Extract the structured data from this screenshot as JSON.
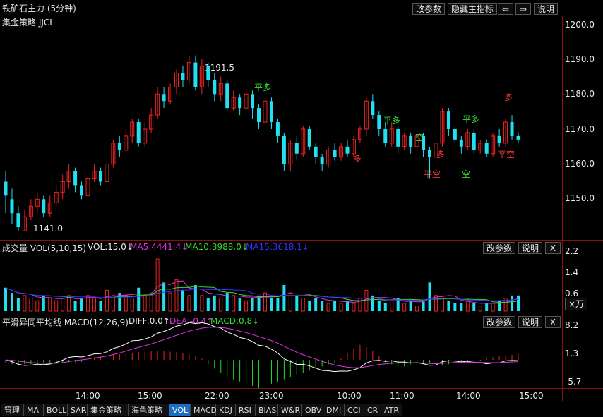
{
  "title": "铁矿石主力 (5分钟)",
  "toolbar": {
    "params": "改参数",
    "hide_indicator": "隐藏主指标",
    "left": "⇐",
    "right": "⇒",
    "help": "说明"
  },
  "main": {
    "strategy": "集金策略 JJCL",
    "y_labels": [
      "1200.0",
      "1190.0",
      "1180.0",
      "1170.0",
      "1160.0",
      "1150.0"
    ],
    "high_label": "1191.5",
    "low_label": "1141.0",
    "signals": [
      {
        "text": "平多",
        "color": "#33dd33"
      },
      {
        "text": "多",
        "color": "#ee3333"
      },
      {
        "text": "平多",
        "color": "#33dd33"
      },
      {
        "text": "空",
        "color": "#33dd33"
      },
      {
        "text": "多",
        "color": "#ee3333"
      },
      {
        "text": "平空",
        "color": "#ee3333"
      },
      {
        "text": "平多",
        "color": "#33dd33"
      },
      {
        "text": "空",
        "color": "#33dd33"
      },
      {
        "text": "多",
        "color": "#ee3333"
      },
      {
        "text": "平空",
        "color": "#ee3333"
      }
    ]
  },
  "volume": {
    "title": "成交量 VOL(5,10,15)",
    "vol": "VOL:15.0↓",
    "ma5": "MA5:4441.4↓",
    "ma10": "MA10:3988.0↓",
    "ma15": "MA15:3618.1↓",
    "params": "改参数",
    "help": "说明",
    "close": "X",
    "y_labels": [
      "2.2",
      "1.4",
      "0.6"
    ],
    "unit": "×万",
    "colors": {
      "ma5": "#dd33dd",
      "ma10": "#33dd33",
      "ma15": "#3333ff"
    }
  },
  "macd": {
    "title": "平滑异同平均线 MACD(12,26,9)",
    "diff": "DIFF:0.0↑",
    "dea": "DEA:-0.4↑",
    "macd": "MACD:0.8↓",
    "params": "改参数",
    "help": "说明",
    "close": "X",
    "y_labels": [
      "8.2",
      "1.3",
      "-5.7"
    ]
  },
  "x_labels": [
    "14:00",
    "15:00",
    "22:00",
    "23:00",
    "10:00",
    "11:00",
    "14:00",
    "15:00"
  ],
  "tabs": [
    "管理",
    "MA",
    "BOLL",
    "SAR",
    "集金策略",
    "海龟策略",
    "VOL",
    "MACD",
    "KDJ",
    "RSI",
    "BIAS",
    "W&R",
    "OBV",
    "DMI",
    "CCI",
    "CR",
    "ATR"
  ],
  "active_tab": "VOL",
  "chart_data": {
    "type": "candlestick",
    "ylim": [
      1140,
      1202
    ],
    "candles": [
      [
        1155,
        1151,
        1158,
        1146
      ],
      [
        1150,
        1146,
        1153,
        1143
      ],
      [
        1146,
        1142,
        1148,
        1141
      ],
      [
        1141,
        1145,
        1147,
        1141
      ],
      [
        1145,
        1148,
        1150,
        1144
      ],
      [
        1148,
        1150,
        1152,
        1146
      ],
      [
        1150,
        1146,
        1151,
        1145
      ],
      [
        1146,
        1149,
        1151,
        1145
      ],
      [
        1149,
        1152,
        1154,
        1148
      ],
      [
        1152,
        1155,
        1157,
        1150
      ],
      [
        1155,
        1158,
        1160,
        1153
      ],
      [
        1158,
        1154,
        1159,
        1152
      ],
      [
        1154,
        1151,
        1155,
        1150
      ],
      [
        1151,
        1156,
        1157,
        1150
      ],
      [
        1156,
        1158,
        1160,
        1155
      ],
      [
        1158,
        1155,
        1159,
        1154
      ],
      [
        1155,
        1160,
        1162,
        1154
      ],
      [
        1160,
        1166,
        1167,
        1159
      ],
      [
        1166,
        1164,
        1168,
        1162
      ],
      [
        1164,
        1168,
        1170,
        1163
      ],
      [
        1168,
        1172,
        1173,
        1166
      ],
      [
        1172,
        1166,
        1173,
        1165
      ],
      [
        1166,
        1170,
        1172,
        1165
      ],
      [
        1170,
        1174,
        1176,
        1169
      ],
      [
        1174,
        1180,
        1182,
        1173
      ],
      [
        1180,
        1178,
        1182,
        1176
      ],
      [
        1178,
        1182,
        1183,
        1177
      ],
      [
        1182,
        1186,
        1187,
        1180
      ],
      [
        1186,
        1184,
        1188,
        1182
      ],
      [
        1184,
        1189,
        1191,
        1183
      ],
      [
        1189,
        1182,
        1191,
        1181
      ],
      [
        1182,
        1188,
        1190,
        1180
      ],
      [
        1188,
        1184,
        1189,
        1182
      ],
      [
        1184,
        1180,
        1186,
        1178
      ],
      [
        1180,
        1183,
        1185,
        1178
      ],
      [
        1183,
        1176,
        1184,
        1175
      ],
      [
        1176,
        1179,
        1181,
        1175
      ],
      [
        1179,
        1176,
        1180,
        1174
      ],
      [
        1176,
        1180,
        1182,
        1175
      ],
      [
        1180,
        1176,
        1181,
        1173
      ],
      [
        1176,
        1172,
        1177,
        1170
      ],
      [
        1172,
        1178,
        1179,
        1171
      ],
      [
        1178,
        1172,
        1179,
        1170
      ],
      [
        1172,
        1168,
        1173,
        1166
      ],
      [
        1168,
        1160,
        1169,
        1158
      ],
      [
        1160,
        1166,
        1167,
        1158
      ],
      [
        1166,
        1163,
        1168,
        1161
      ],
      [
        1163,
        1170,
        1171,
        1162
      ],
      [
        1170,
        1165,
        1171,
        1164
      ],
      [
        1165,
        1162,
        1166,
        1160
      ],
      [
        1162,
        1160,
        1163,
        1158
      ],
      [
        1160,
        1164,
        1165,
        1159
      ],
      [
        1164,
        1162,
        1166,
        1161
      ],
      [
        1162,
        1165,
        1166,
        1161
      ],
      [
        1165,
        1163,
        1167,
        1162
      ],
      [
        1163,
        1167,
        1168,
        1162
      ],
      [
        1167,
        1170,
        1171,
        1166
      ],
      [
        1170,
        1178,
        1179,
        1168
      ],
      [
        1178,
        1174,
        1180,
        1173
      ],
      [
        1174,
        1170,
        1175,
        1168
      ],
      [
        1170,
        1166,
        1172,
        1165
      ],
      [
        1166,
        1170,
        1172,
        1165
      ],
      [
        1170,
        1165,
        1171,
        1163
      ],
      [
        1165,
        1168,
        1169,
        1164
      ],
      [
        1168,
        1165,
        1169,
        1163
      ],
      [
        1165,
        1168,
        1170,
        1164
      ],
      [
        1168,
        1164,
        1169,
        1162
      ],
      [
        1164,
        1162,
        1165,
        1156
      ],
      [
        1162,
        1166,
        1167,
        1160
      ],
      [
        1166,
        1175,
        1176,
        1165
      ],
      [
        1175,
        1170,
        1176,
        1168
      ],
      [
        1170,
        1167,
        1171,
        1166
      ],
      [
        1167,
        1165,
        1168,
        1163
      ],
      [
        1165,
        1169,
        1170,
        1164
      ],
      [
        1169,
        1164,
        1170,
        1163
      ],
      [
        1164,
        1166,
        1167,
        1163
      ],
      [
        1166,
        1163,
        1167,
        1162
      ],
      [
        1163,
        1168,
        1169,
        1162
      ],
      [
        1168,
        1166,
        1170,
        1165
      ],
      [
        1166,
        1172,
        1173,
        1165
      ],
      [
        1172,
        1168,
        1174,
        1167
      ],
      [
        1168,
        1167,
        1169,
        1166
      ]
    ],
    "volumes": [
      0.9,
      0.7,
      0.5,
      0.6,
      0.5,
      0.4,
      0.6,
      0.5,
      0.4,
      0.5,
      0.6,
      0.4,
      0.5,
      0.6,
      0.5,
      0.4,
      0.8,
      0.6,
      0.7,
      0.6,
      0.5,
      0.9,
      0.6,
      0.7,
      2.0,
      1.1,
      0.7,
      1.2,
      0.8,
      0.6,
      1.0,
      0.6,
      0.5,
      0.6,
      0.5,
      0.7,
      0.6,
      0.5,
      0.4,
      0.5,
      0.6,
      0.7,
      0.5,
      0.5,
      1.0,
      0.7,
      0.6,
      0.5,
      0.4,
      0.5,
      0.4,
      0.3,
      0.4,
      0.3,
      0.4,
      0.3,
      0.5,
      0.8,
      0.6,
      0.4,
      0.3,
      0.4,
      0.5,
      0.3,
      0.4,
      0.2,
      0.4,
      1.1,
      0.6,
      0.5,
      0.4,
      0.3,
      0.3,
      0.4,
      0.3,
      0.2,
      0.3,
      0.3,
      0.4,
      0.5,
      0.6,
      0.6
    ],
    "macd_hist": [
      -0.8,
      -1.0,
      -1.1,
      -1.0,
      -1.0,
      -0.9,
      -0.8,
      -0.8,
      -0.7,
      -0.6,
      -0.5,
      -0.5,
      -0.4,
      0.4,
      0.6,
      0.8,
      1.0,
      1.2,
      1.3,
      1.5,
      1.6,
      1.8,
      1.9,
      2.0,
      2.1,
      2.0,
      1.9,
      1.8,
      1.5,
      1.2,
      0.8,
      0.3,
      -1.0,
      -2.0,
      -3.0,
      -4.0,
      -4.5,
      -5.0,
      -5.5,
      -6.0,
      -6.5,
      -6.0,
      -5.5,
      -5.0,
      -4.5,
      -4.0,
      -3.5,
      -3.0,
      -2.5,
      -2.0,
      -1.5,
      -1.0,
      -0.8,
      0.5,
      1.5,
      2.5,
      3.5,
      3.0,
      2.0,
      1.0,
      -0.5,
      -1.0,
      -1.5,
      -1.5,
      -1.0,
      -0.8,
      -0.6,
      -0.8,
      -1.0,
      -1.2,
      -1.0,
      -0.8,
      -0.6,
      -0.5,
      -0.4,
      -0.3,
      0.4,
      0.6,
      0.8,
      1.0,
      1.2,
      1.4
    ],
    "y_range": [
      -5.7,
      8.2
    ]
  }
}
